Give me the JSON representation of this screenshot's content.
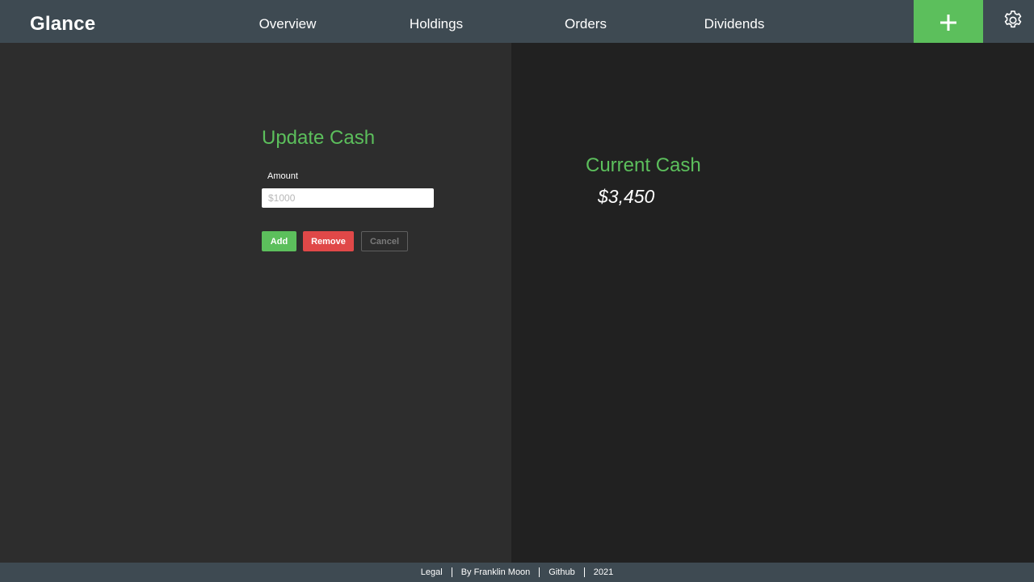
{
  "brand": "Glance",
  "nav": {
    "items": [
      {
        "label": "Overview"
      },
      {
        "label": "Holdings"
      },
      {
        "label": "Orders"
      },
      {
        "label": "Dividends"
      }
    ],
    "add_icon": "plus-icon",
    "settings_icon": "gear-icon"
  },
  "update_cash": {
    "title": "Update Cash",
    "amount_label": "Amount",
    "amount_placeholder": "$1000",
    "add_label": "Add",
    "remove_label": "Remove",
    "cancel_label": "Cancel"
  },
  "current_cash": {
    "title": "Current Cash",
    "value": "$3,450"
  },
  "footer": {
    "legal": "Legal",
    "author": "By Franklin Moon",
    "github": "Github",
    "year": "2021"
  },
  "colors": {
    "accent_green": "#5cbf5c",
    "danger_red": "#e04848",
    "header_bg": "#3e4a52",
    "left_bg": "#2d2d2d",
    "right_bg": "#212121"
  }
}
